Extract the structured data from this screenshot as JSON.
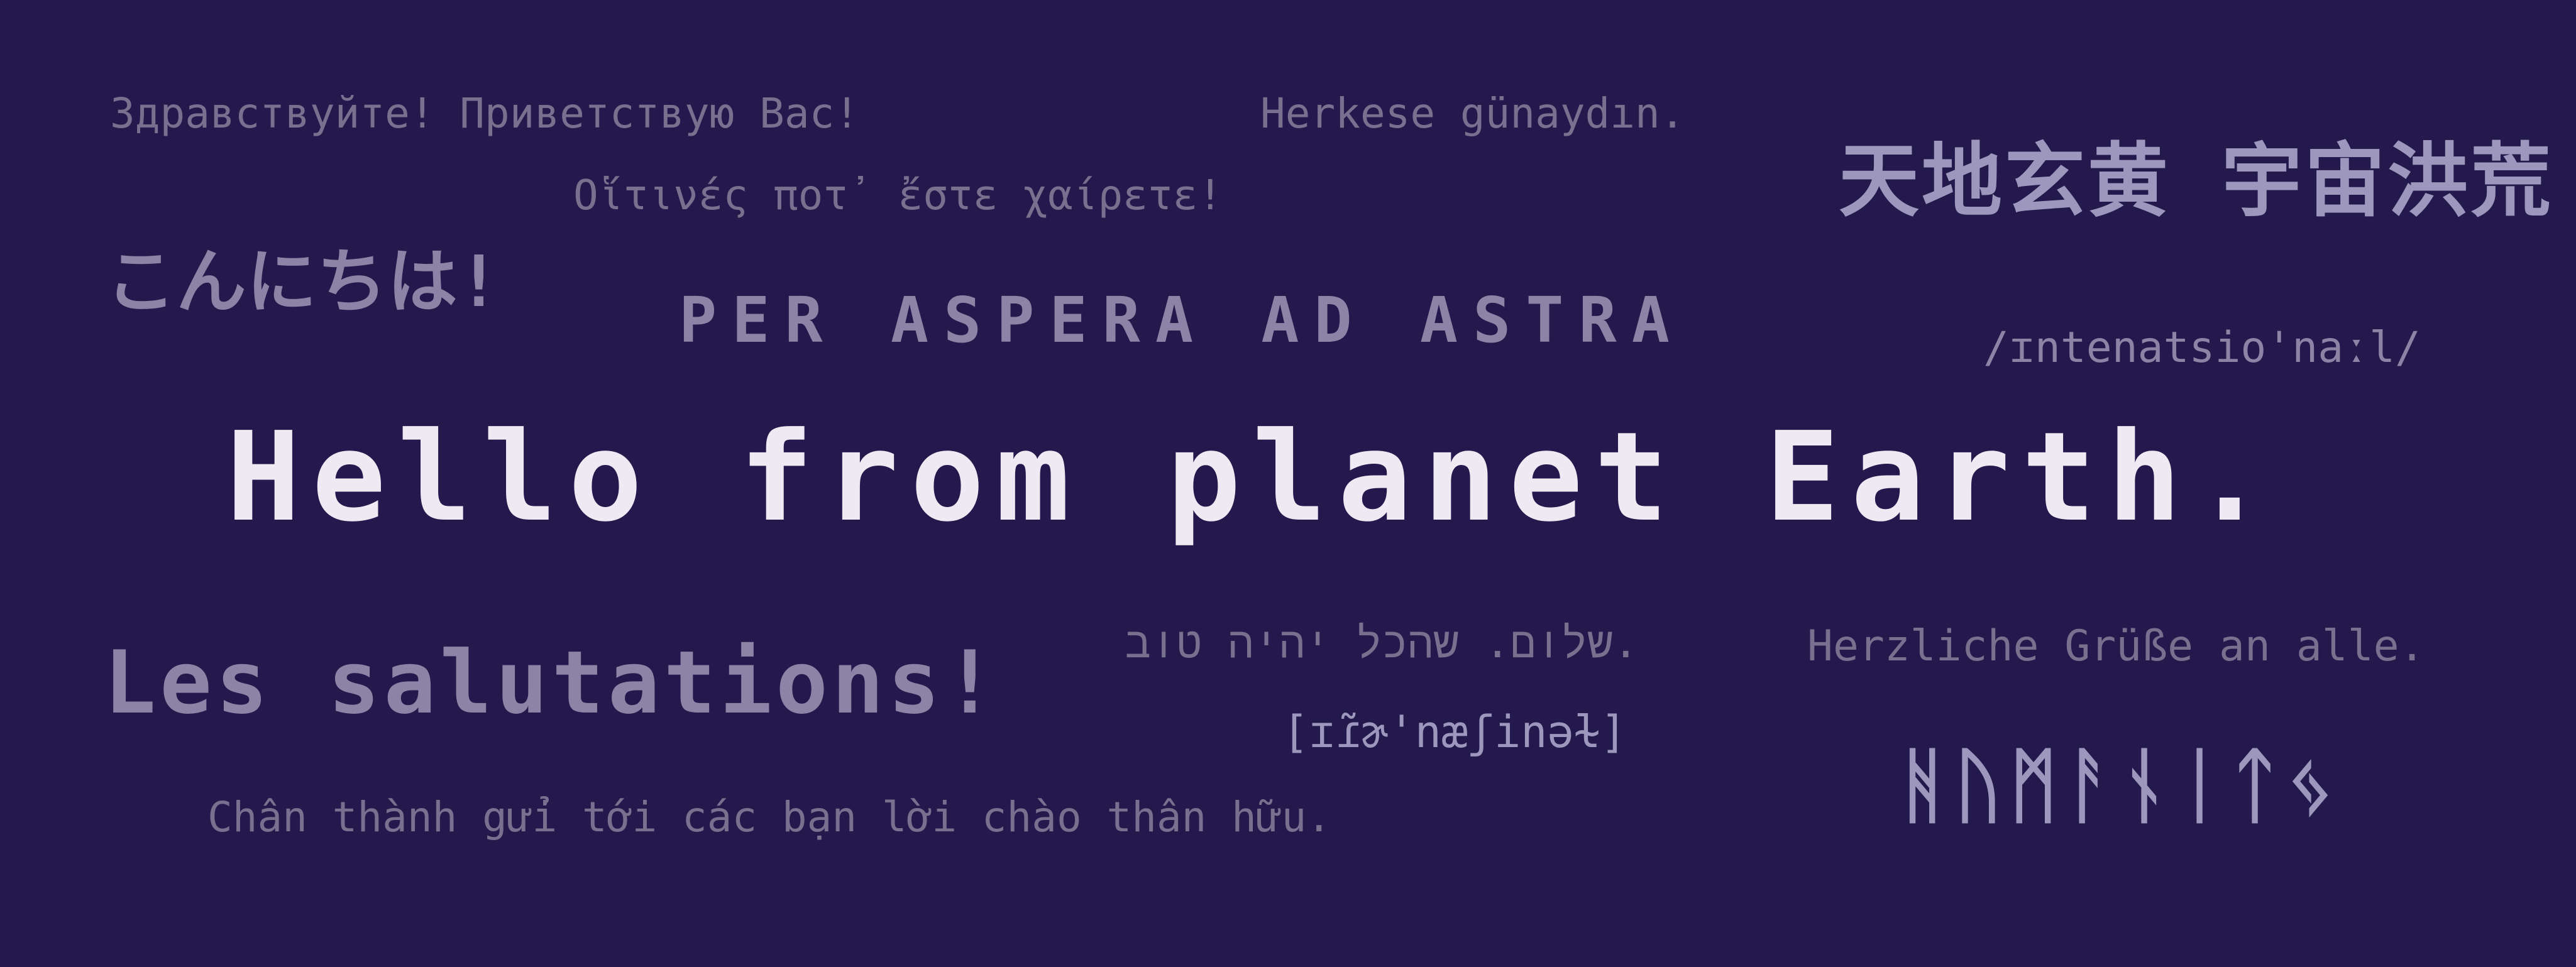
{
  "greetings": {
    "russian": "Здравствуйте! Приветствую Вас!",
    "turkish": "Herkese günaydın.",
    "greek": "Οἵτινές ποτ᾽ ἔστε χαίρετε!",
    "japanese": "こんにちは!",
    "latin": "PER ASPERA AD ASTRA",
    "ipa_international": "/ɪntenatsio'naːl/",
    "hero": "Hello from planet Earth.",
    "french": "Les salutations!",
    "hebrew": "שלום. שהכל יהיה טוב.",
    "german": "Herzliche Grüße an alle.",
    "ipa_bracket": "[ɪɾ̃ɚ'næʃinəɫ]",
    "vietnamese": "Chân thành gửi tới các bạn lời chào thân hữu.",
    "chinese": "天地玄黄 宇宙洪荒",
    "runes": "ᚻᚢᛗᚨᚾᛁᛏᛃ"
  },
  "colors": {
    "background": "#23194c",
    "hero_text": "#eeeaf4",
    "secondary_text": "#8b84a6"
  }
}
